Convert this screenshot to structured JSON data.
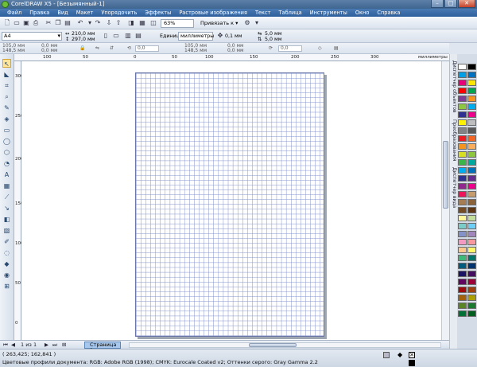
{
  "window": {
    "title": "CorelDRAW X5 - [Безымянный-1]",
    "min": "–",
    "max": "□",
    "close": "✕"
  },
  "menu": [
    "Файл",
    "Правка",
    "Вид",
    "Макет",
    "Упорядочить",
    "Эффекты",
    "Растровые изображения",
    "Текст",
    "Таблица",
    "Инструменты",
    "Окно",
    "Справка"
  ],
  "toolbar": {
    "zoom": "63%",
    "snap_label": "Привязать к ▾"
  },
  "propbar": {
    "paper": "A4",
    "width": "210,0 мм",
    "height": "297,0 мм",
    "units_label": "Единицы:",
    "units_value": "миллиметры",
    "nudge": "0,1 мм",
    "dup_x": "5,0 мм",
    "dup_y": "5,0 мм"
  },
  "propbar2": {
    "x": "105,0 мм",
    "y": "148,5 мм",
    "w": "0,0 мм",
    "h": "0,0 мм",
    "angle": "0,0",
    "x2": "105,0 мм",
    "y2": "148,5 мм",
    "w2": "0,0 мм",
    "h2": "0,0 мм",
    "angle2": "0,0"
  },
  "rulers": {
    "h_ticks": [
      "100",
      "50",
      "0",
      "50",
      "100",
      "150",
      "200",
      "250",
      "300"
    ],
    "h_unit": "миллиметры",
    "v_ticks": [
      "300",
      "250",
      "200",
      "150",
      "100",
      "50",
      "0"
    ],
    "v_unit": "миллиметры"
  },
  "dockers": [
    "Диспетчер объектов",
    "Преобразования",
    "Диспетчер вида"
  ],
  "pages": {
    "counter": "1 из 1",
    "tab": "Страница 1"
  },
  "status": {
    "coords": "( 263,425; 162,841 )",
    "profiles": "Цветовые профили документа: RGB: Adobe RGB (1998); CMYK: Eurocale Coated v2; Оттенки серого: Gray Gamma 2.2"
  },
  "palette_colors": [
    "#ffffff",
    "#000000",
    "#00a0e8",
    "#0070c0",
    "#e8007a",
    "#ffe600",
    "#ff0000",
    "#00a650",
    "#7f3f98",
    "#f7941d",
    "#8dc63f",
    "#00aeef",
    "#2e3192",
    "#ec008c",
    "#fff200",
    "#bcbec0",
    "#808285",
    "#58595b",
    "#ed1c24",
    "#f26522",
    "#f7941d",
    "#fbaf5d",
    "#d7df23",
    "#8dc63f",
    "#39b54a",
    "#00a99d",
    "#00aeef",
    "#0072bc",
    "#2e3192",
    "#662d91",
    "#92278f",
    "#ec008c",
    "#ed145b",
    "#c69c6d",
    "#a67c52",
    "#8c6239",
    "#754c24",
    "#603813",
    "#fff799",
    "#c4df9b",
    "#7accc8",
    "#6dcff6",
    "#8393ca",
    "#a186be",
    "#f49ac2",
    "#f6989d",
    "#fdc68a",
    "#fff568",
    "#3cb878",
    "#00746b",
    "#005b7f",
    "#003471",
    "#1b1464",
    "#440e62",
    "#630460",
    "#9e0039",
    "#9e0b0f",
    "#a0410d",
    "#a36209",
    "#aba000",
    "#598527",
    "#197b30",
    "#007236",
    "#005e20"
  ]
}
